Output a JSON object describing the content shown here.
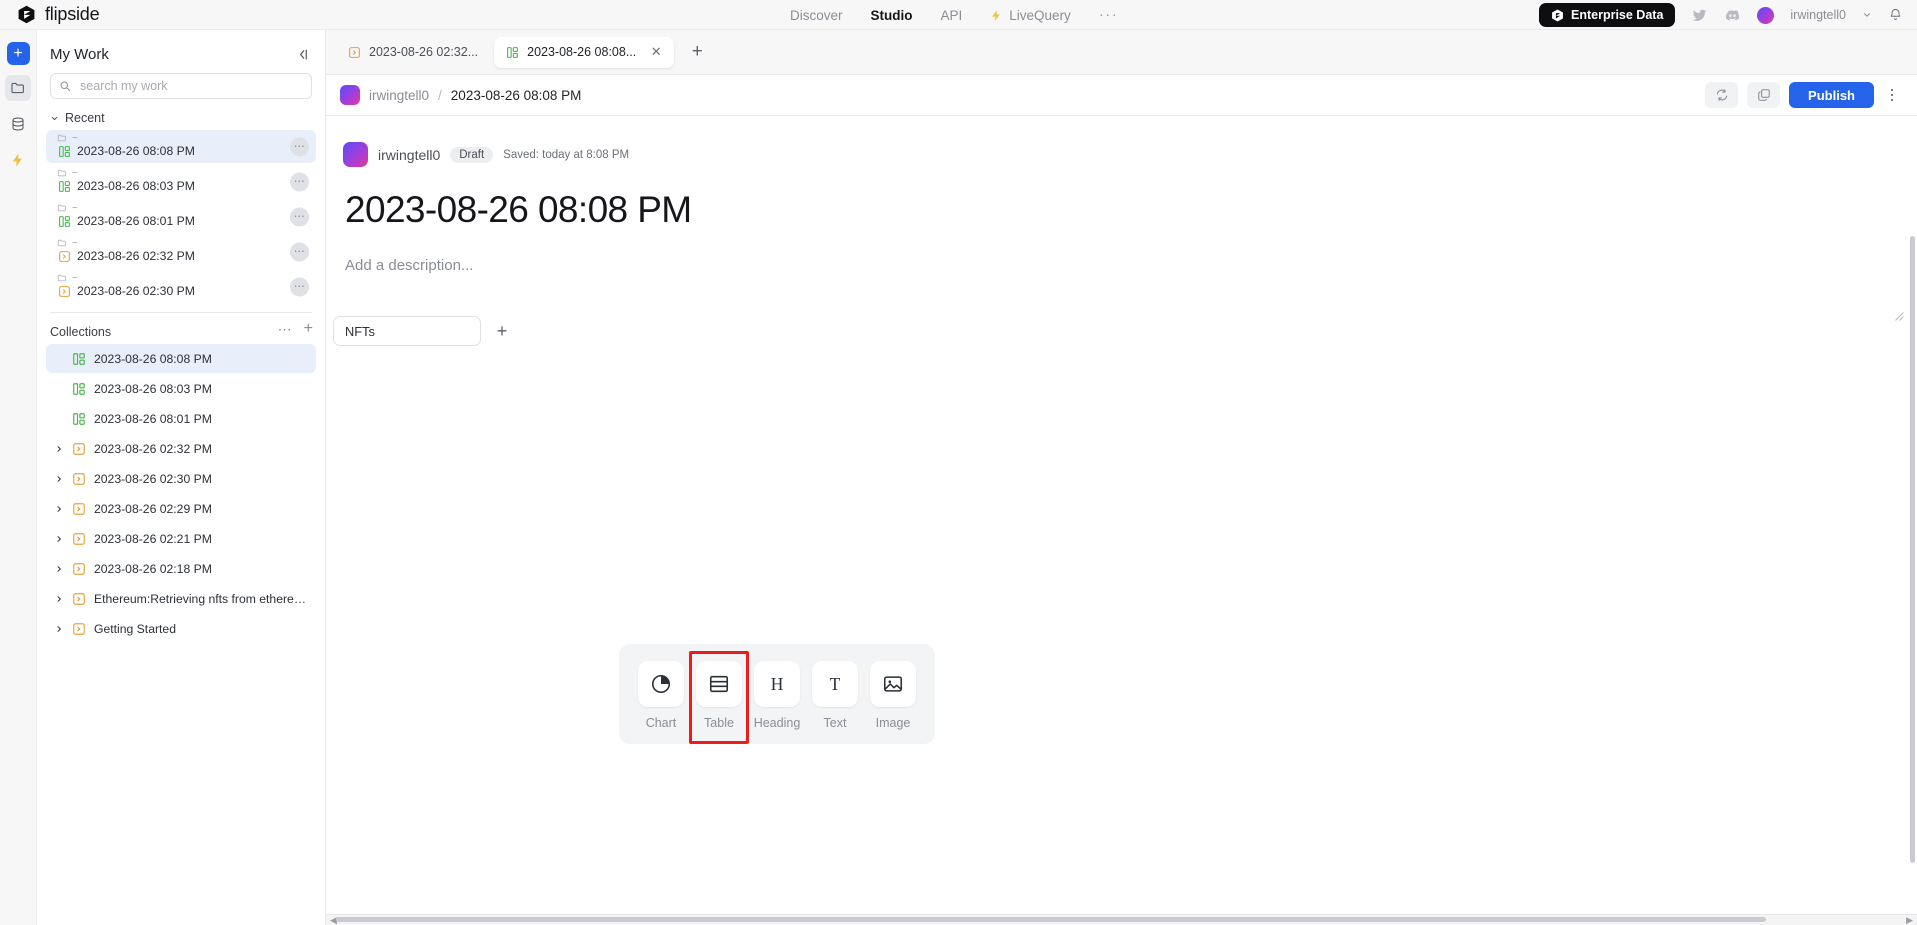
{
  "topbar": {
    "brand": "flipside",
    "nav": [
      {
        "label": "Discover",
        "active": false
      },
      {
        "label": "Studio",
        "active": true
      },
      {
        "label": "API",
        "active": false
      },
      {
        "label": "LiveQuery",
        "active": false
      }
    ],
    "overflow": "···",
    "enterprise_label": "Enterprise Data",
    "username": "irwingtell0"
  },
  "sidebar": {
    "title": "My Work",
    "search": {
      "value": "",
      "placeholder": "search my work"
    },
    "recent_section": {
      "label": "Recent"
    },
    "recent": [
      {
        "parent": "~",
        "label": "2023-08-26 08:08 PM",
        "kind": "dashboard",
        "selected": true
      },
      {
        "parent": "~",
        "label": "2023-08-26 08:03 PM",
        "kind": "dashboard",
        "selected": false
      },
      {
        "parent": "~",
        "label": "2023-08-26 08:01 PM",
        "kind": "dashboard",
        "selected": false
      },
      {
        "parent": "~",
        "label": "2023-08-26 02:32 PM",
        "kind": "query",
        "selected": false
      },
      {
        "parent": "~",
        "label": "2023-08-26 02:30 PM",
        "kind": "query",
        "selected": false
      }
    ],
    "collections_section": {
      "label": "Collections"
    },
    "collections": [
      {
        "label": "2023-08-26 08:08 PM",
        "kind": "dashboard",
        "expandable": false,
        "selected": true
      },
      {
        "label": "2023-08-26 08:03 PM",
        "kind": "dashboard",
        "expandable": false,
        "selected": false
      },
      {
        "label": "2023-08-26 08:01 PM",
        "kind": "dashboard",
        "expandable": false,
        "selected": false
      },
      {
        "label": "2023-08-26 02:32 PM",
        "kind": "query",
        "expandable": true,
        "selected": false
      },
      {
        "label": "2023-08-26 02:30 PM",
        "kind": "query",
        "expandable": true,
        "selected": false
      },
      {
        "label": "2023-08-26 02:29 PM",
        "kind": "query",
        "expandable": true,
        "selected": false
      },
      {
        "label": "2023-08-26 02:21 PM",
        "kind": "query",
        "expandable": true,
        "selected": false
      },
      {
        "label": "2023-08-26 02:18 PM",
        "kind": "query",
        "expandable": true,
        "selected": false
      },
      {
        "label": "Ethereum:Retrieving nfts from ethereum...",
        "kind": "query",
        "expandable": true,
        "selected": false
      },
      {
        "label": "Getting Started",
        "kind": "query",
        "expandable": true,
        "selected": false
      }
    ]
  },
  "tabs": [
    {
      "label": "2023-08-26 02:32...",
      "kind": "query",
      "active": false,
      "closable": false
    },
    {
      "label": "2023-08-26 08:08...",
      "kind": "dashboard",
      "active": true,
      "closable": true
    }
  ],
  "breadcrumb": {
    "owner": "irwingtell0",
    "separator": "/",
    "title": "2023-08-26 08:08 PM",
    "publish_label": "Publish"
  },
  "document": {
    "owner": "irwingtell0",
    "status": "Draft",
    "saved": "Saved: today at 8:08 PM",
    "title": "2023-08-26 08:08 PM",
    "description_placeholder": "Add a description...",
    "page_tabs": [
      {
        "label": "NFTs"
      }
    ],
    "add_tab_label": "+"
  },
  "palette": {
    "items": [
      {
        "label": "Chart",
        "icon": "pie-chart-icon",
        "highlighted": false
      },
      {
        "label": "Table",
        "icon": "table-icon",
        "highlighted": true
      },
      {
        "label": "Heading",
        "icon": "heading-icon",
        "highlighted": false
      },
      {
        "label": "Text",
        "icon": "text-icon",
        "highlighted": false
      },
      {
        "label": "Image",
        "icon": "image-icon",
        "highlighted": false
      }
    ],
    "highlight_color": "#ef1b1b"
  },
  "colors": {
    "accent": "#2563eb",
    "dashboard_icon": "#4ab54a",
    "query_icon": "#e8a33d",
    "selected_row": "#e8effb",
    "enterprise_pill": "#0e0e10"
  }
}
